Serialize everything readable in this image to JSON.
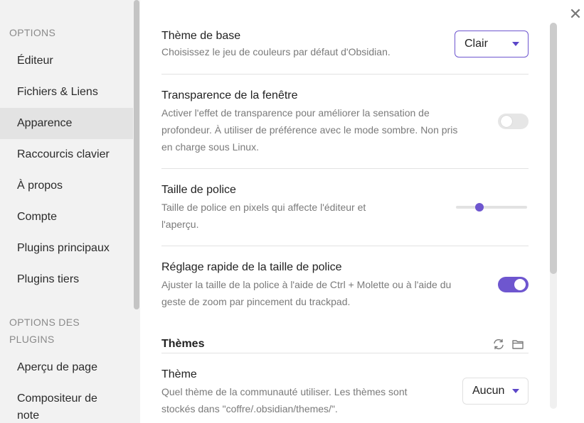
{
  "sidebar": {
    "options_header": "OPTIONS",
    "items": [
      {
        "label": "Éditeur"
      },
      {
        "label": "Fichiers & Liens"
      },
      {
        "label": "Apparence"
      },
      {
        "label": "Raccourcis clavier"
      },
      {
        "label": "À propos"
      },
      {
        "label": "Compte"
      },
      {
        "label": "Plugins principaux"
      },
      {
        "label": "Plugins tiers"
      }
    ],
    "active_item": "Apparence",
    "plugin_options_header_line1": "OPTIONS DES",
    "plugin_options_header_line2": "PLUGINS",
    "plugin_items": [
      {
        "label": "Aperçu de page"
      },
      {
        "label_line1": "Compositeur de",
        "label_line2": "note"
      }
    ]
  },
  "window": {
    "close_icon": "close-icon",
    "close_glyph": "✕"
  },
  "settings": {
    "base_theme": {
      "name": "Thème de base",
      "description": "Choisissez le jeu de couleurs par défaut d'Obsidian.",
      "value": "Clair"
    },
    "translucency": {
      "name": "Transparence de la fenêtre",
      "description_line1": "Activer l'effet de transparence pour améliorer la sensation de",
      "description_line2": "profondeur. À utiliser de préférence avec le mode sombre. Non pris",
      "description_line3": "en charge sous Linux.",
      "enabled": false
    },
    "font_size": {
      "name": "Taille de police",
      "description_line1": "Taille de police en pixels qui affecte l'éditeur et",
      "description_line2": "l'aperçu.",
      "slider_fraction": 0.33
    },
    "quick_font_adjust": {
      "name": "Réglage rapide de la taille de police",
      "description_line1": "Ajuster la taille de la police à l'aide de Ctrl + Molette ou à l'aide du",
      "description_line2": "geste de zoom par pincement du trackpad.",
      "enabled": true
    },
    "themes_section": {
      "title": "Thèmes",
      "reload_icon": "reload-icon",
      "folder_icon": "folder-icon"
    },
    "theme": {
      "name": "Thème",
      "description_line1": "Quel thème de la communauté utiliser. Les thèmes sont",
      "description_line2": "stockés dans \"coffre/.obsidian/themes/\".",
      "value": "Aucun"
    }
  },
  "colors": {
    "accent": "#6e56cf",
    "toggle_off": "#e6e6e6",
    "sidebar_bg": "#f2f2f2",
    "sidebar_active": "#e3e3e3"
  }
}
